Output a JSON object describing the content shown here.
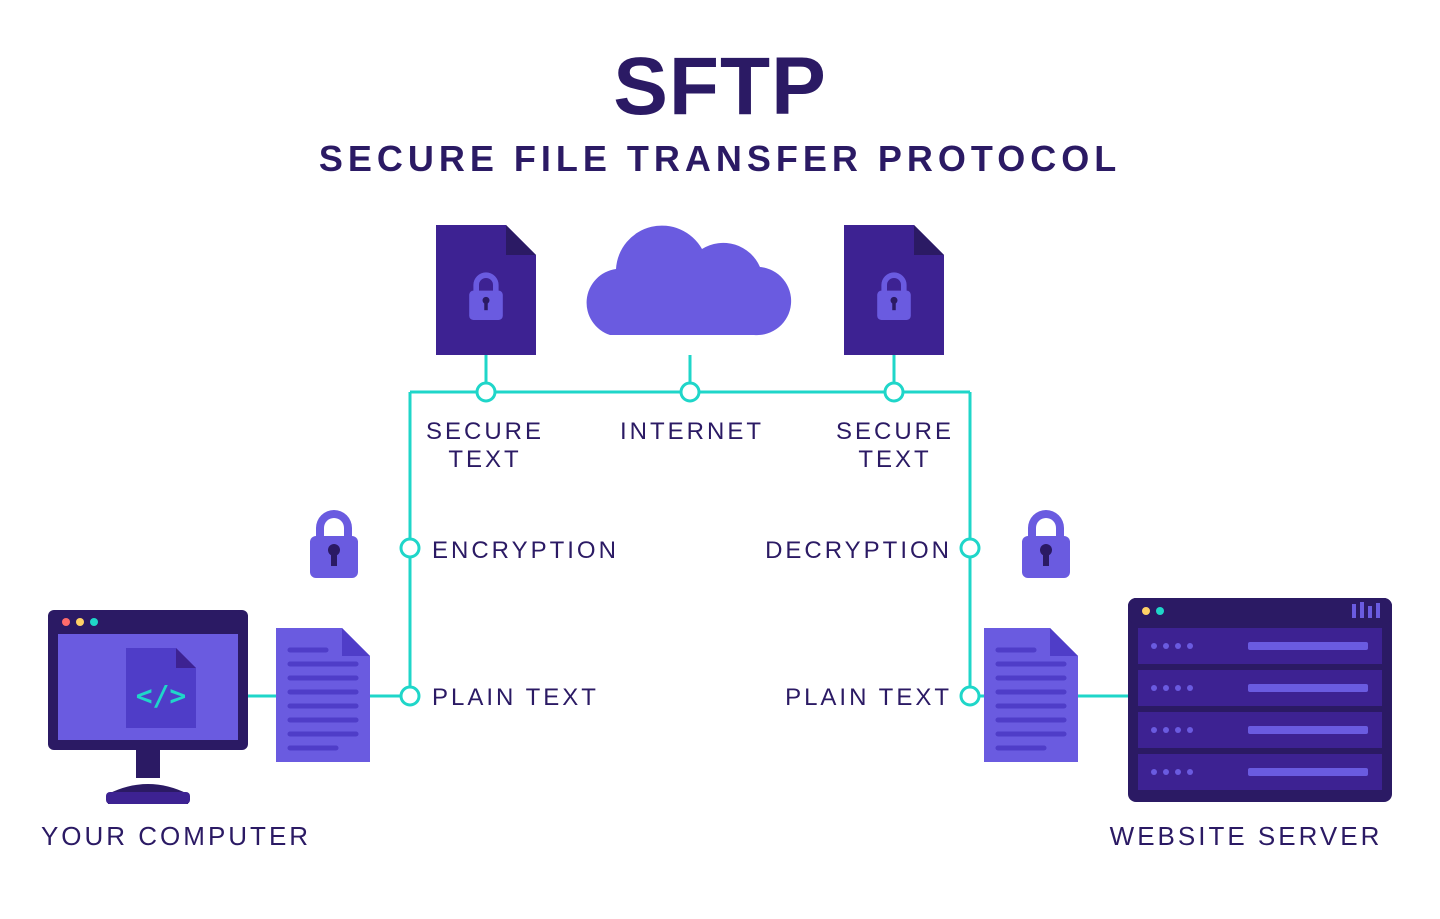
{
  "title": {
    "main": "SFTP",
    "sub": "SECURE FILE TRANSFER PROTOCOL"
  },
  "labels": {
    "internet": "INTERNET",
    "secure_text_left": "SECURE\nTEXT",
    "secure_text_right": "SECURE\nTEXT",
    "encryption": "ENCRYPTION",
    "decryption": "DECRYPTION",
    "plain_text_left": "PLAIN TEXT",
    "plain_text_right": "PLAIN TEXT",
    "your_computer": "YOUR COMPUTER",
    "website_server": "WEBSITE SERVER"
  },
  "colors": {
    "dark_purple": "#2b1a64",
    "light_purple": "#6a5be0",
    "mid_purple": "#4f3dc8",
    "cyan": "#1fd6c9",
    "background": "#ffffff"
  }
}
